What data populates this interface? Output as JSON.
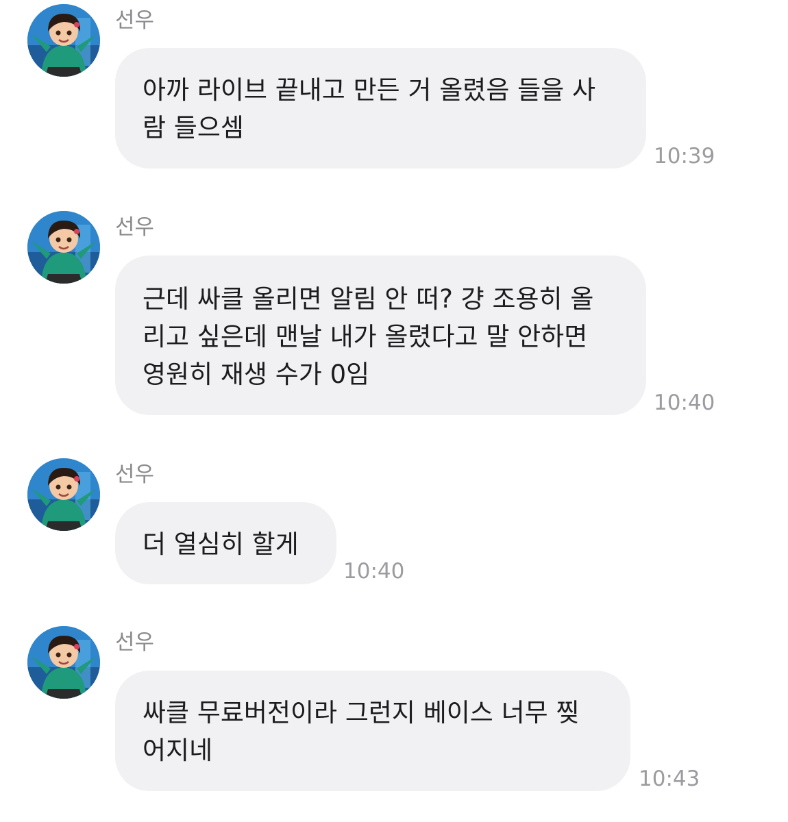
{
  "messages": [
    {
      "sender": "선우",
      "avatar_icon": "girl-character-avatar-icon",
      "lines": [
        "아까 라이브 끝내고 만든 거 올렸음 들을 사",
        "람 들으셈"
      ],
      "time": "10:39"
    },
    {
      "sender": "선우",
      "avatar_icon": "girl-character-avatar-icon",
      "lines": [
        "근데 싸클 올리면 알림 안 떠? 걍 조용히 올",
        "리고 싶은데 맨날 내가 올렸다고 말 안하면",
        "영원히 재생 수가 0임"
      ],
      "time": "10:40"
    },
    {
      "sender": "선우",
      "avatar_icon": "girl-character-avatar-icon",
      "lines": [
        "더 열심히 할게"
      ],
      "time": "10:40"
    },
    {
      "sender": "선우",
      "avatar_icon": "girl-character-avatar-icon",
      "lines": [
        "싸클 무료버전이라 그런지 베이스 너무 찢",
        "어지네"
      ],
      "time": "10:43"
    }
  ],
  "colors": {
    "bubble": "#f1f1f4",
    "text": "#1c1c1e",
    "sender": "#8a8a8e",
    "time": "#9b9ba0"
  }
}
